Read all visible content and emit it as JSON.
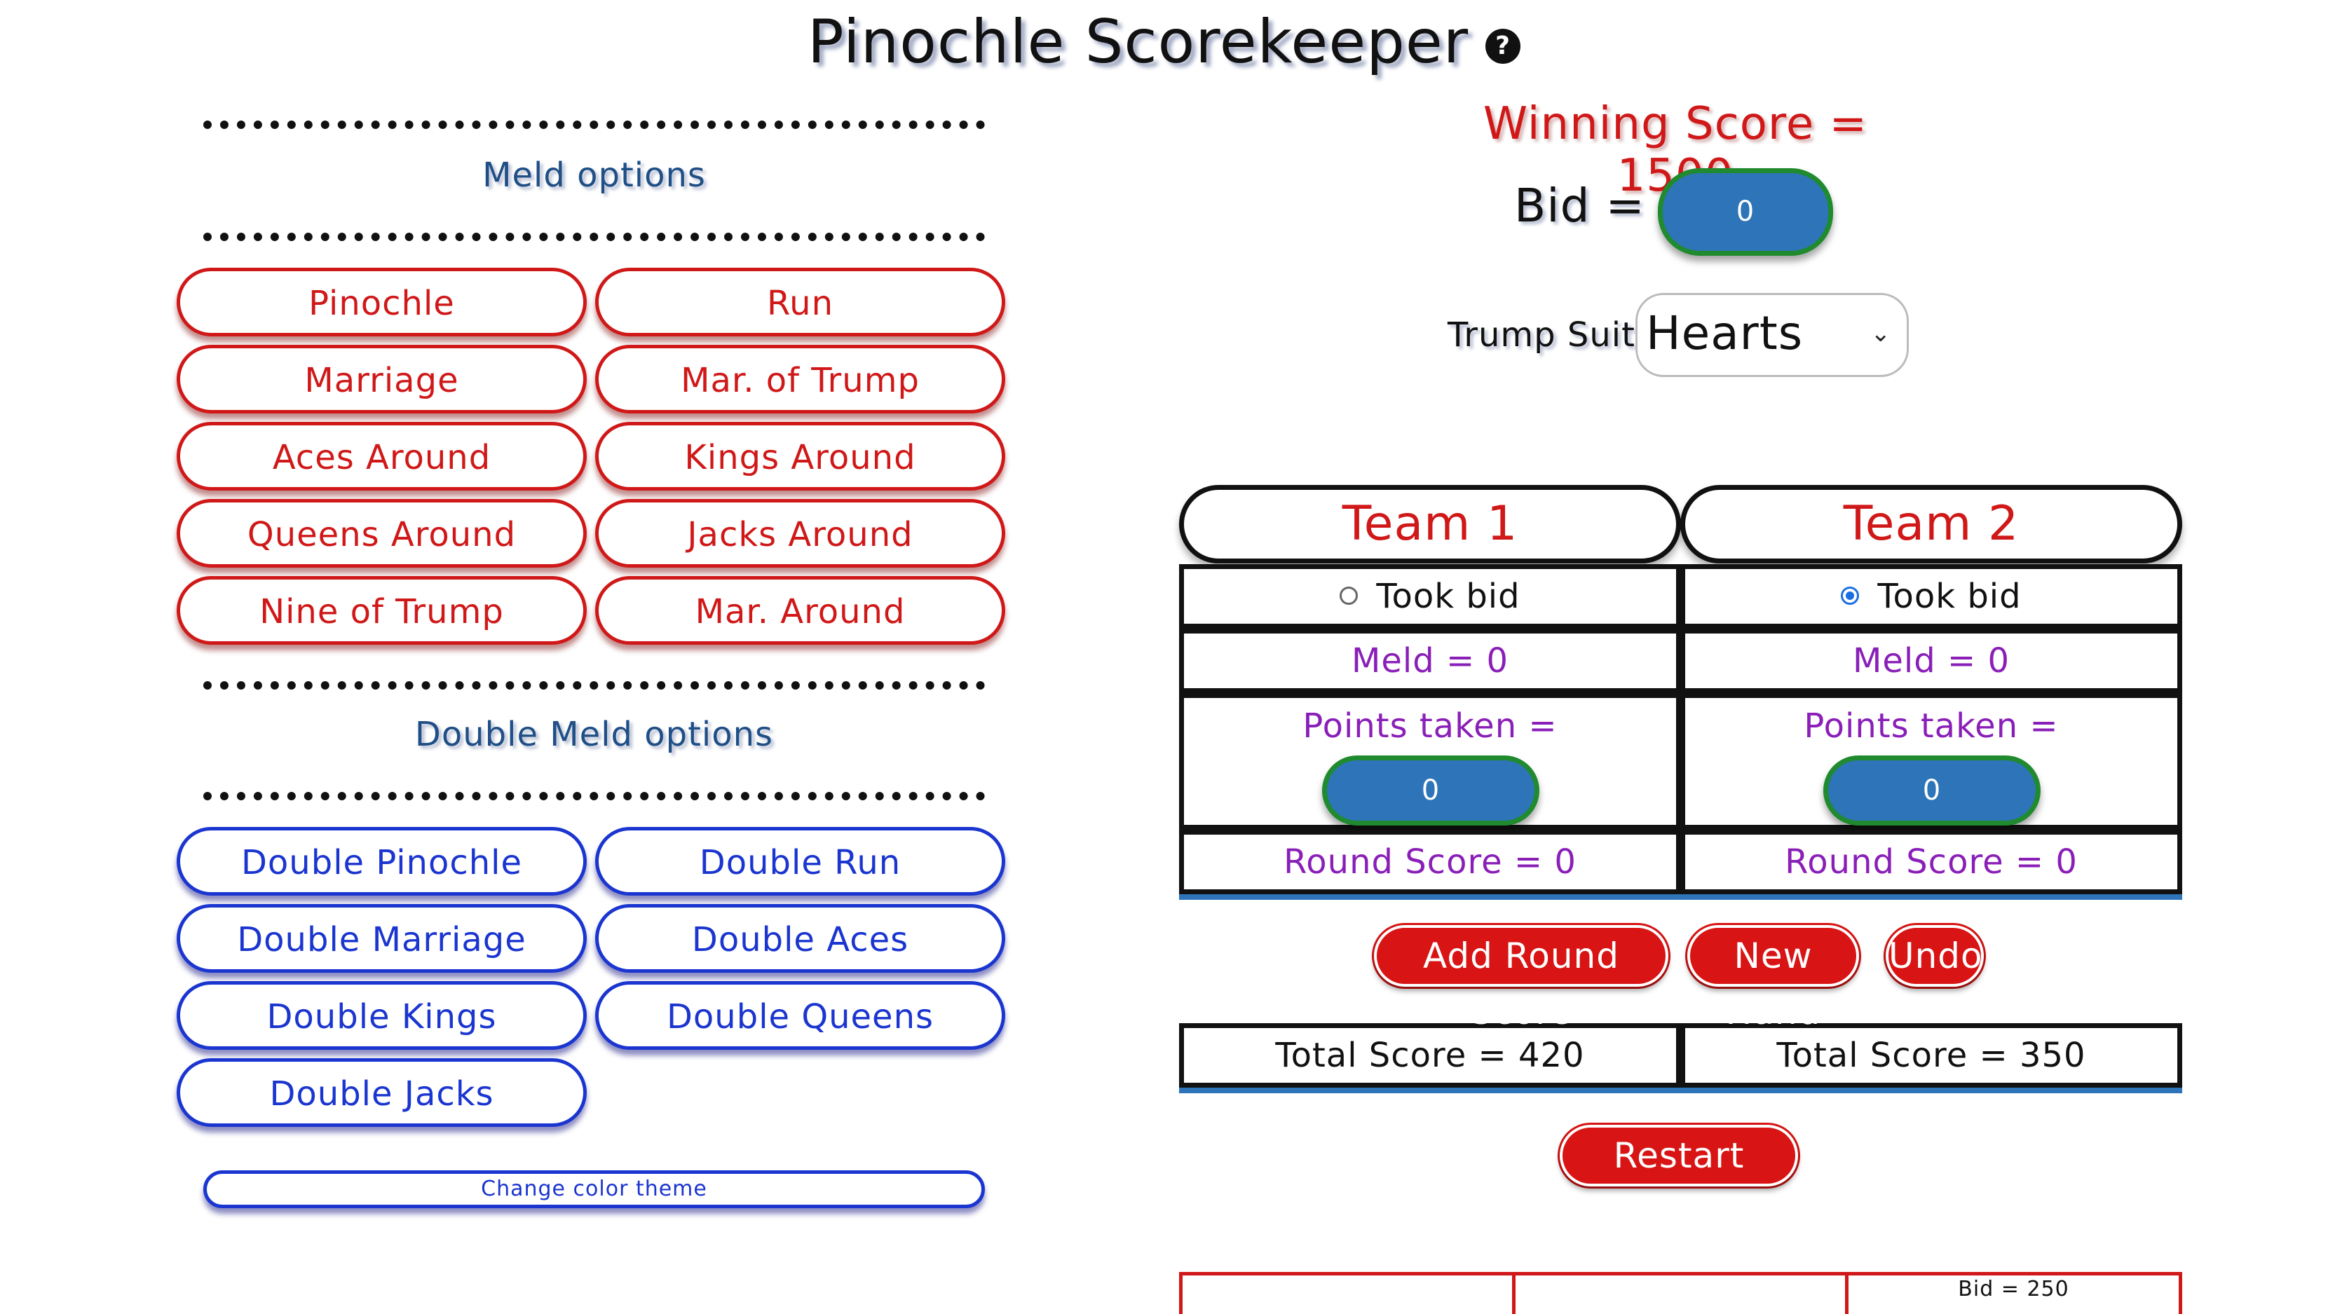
{
  "header": {
    "title": "Pinochle Scorekeeper",
    "help_icon": "question-circle-icon"
  },
  "meld": {
    "heading": "Meld options",
    "items": [
      "Pinochle",
      "Run",
      "Marriage",
      "Mar. of Trump",
      "Aces Around",
      "Kings Around",
      "Queens Around",
      "Jacks Around",
      "Nine of Trump",
      "Mar. Around"
    ]
  },
  "double_meld": {
    "heading": "Double Meld options",
    "items": [
      "Double Pinochle",
      "Double Run",
      "Double Marriage",
      "Double Aces",
      "Double Kings",
      "Double Queens",
      "Double Jacks"
    ]
  },
  "theme": {
    "button_label": "Change color theme"
  },
  "game": {
    "winning_score": "Winning Score = 1500",
    "bid_label": "Bid =",
    "bid_value": "0",
    "trump_label": "Trump Suit:",
    "trump_value": "Hearts"
  },
  "teams": [
    {
      "name": "Team 1",
      "took_bid": "Took bid",
      "took_bid_checked": false,
      "meld": "Meld = 0",
      "points_label": "Points taken =",
      "points_value": "0",
      "round_score": "Round Score = 0",
      "total_score": "Total Score = 420"
    },
    {
      "name": "Team 2",
      "took_bid": "Took bid",
      "took_bid_checked": true,
      "meld": "Meld = 0",
      "points_label": "Points taken =",
      "points_value": "0",
      "round_score": "Round Score = 0",
      "total_score": "Total Score = 350"
    }
  ],
  "actions": {
    "add_round": "Add Round Score",
    "new_hand": "New Hand",
    "undo": "Undo",
    "restart": "Restart Game"
  },
  "history": {
    "bid": "Bid = 250"
  },
  "colors": {
    "accent_red": "#d01818",
    "accent_blue": "#1a35d0",
    "input_blue": "#2e74b8",
    "input_green": "#1f8a2e",
    "purple": "#8a1fb8"
  }
}
